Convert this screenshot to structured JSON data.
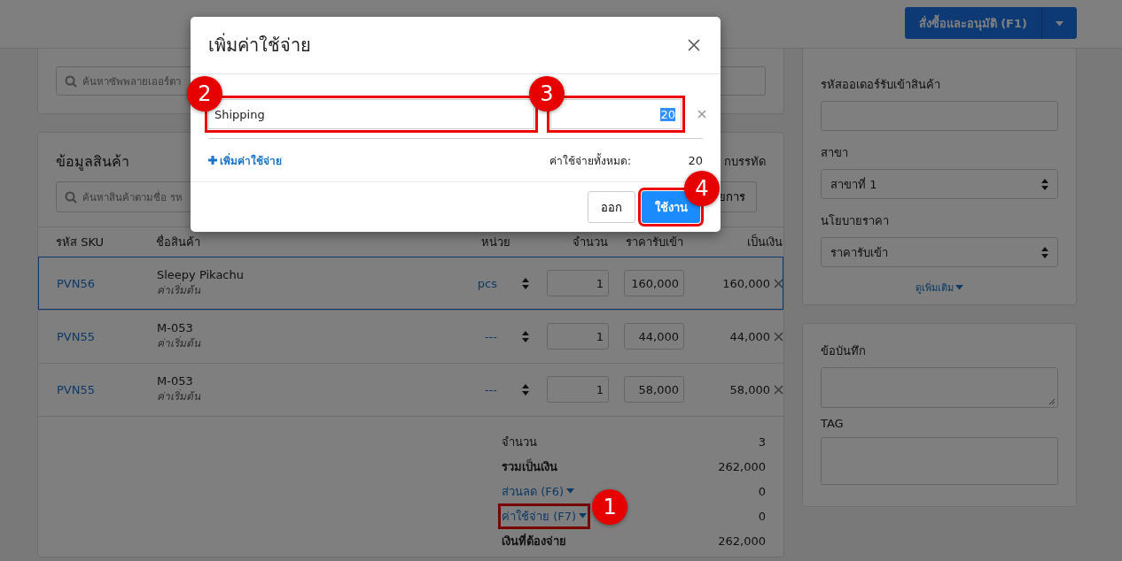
{
  "header": {
    "primary_button": "สั่งซื้อและอนุมัติ (F1)"
  },
  "supplier_card": {
    "search_placeholder": "ค้นหาซัพพลายเออร์ตา"
  },
  "products_card": {
    "title": "ข้อมูลสินค้า",
    "right_link": "กบรรทัด",
    "search_placeholder": "ค้นหาสินค้าตามชื่อ รห",
    "button": "ยการ",
    "columns": [
      "รหัส SKU",
      "ชื่อสินค้า",
      "หน่วย",
      "จำนวน",
      "ราคารับเข้า",
      "เป็นเงิน"
    ],
    "rows": [
      {
        "sku": "PVN56",
        "name": "Sleepy Pikachu",
        "note": "ค่าเริ่มต้น",
        "unit": "pcs",
        "qty": "1",
        "price": "160,000",
        "total": "160,000",
        "selected": true
      },
      {
        "sku": "PVN55",
        "name": "M-053",
        "note": "ค่าเริ่มต้น",
        "unit": "---",
        "qty": "1",
        "price": "44,000",
        "total": "44,000",
        "selected": false
      },
      {
        "sku": "PVN55",
        "name": "M-053",
        "note": "ค่าเริ่มต้น",
        "unit": "---",
        "qty": "1",
        "price": "58,000",
        "total": "58,000",
        "selected": false
      }
    ]
  },
  "summary": [
    {
      "kind": "text",
      "label": "จำนวน",
      "value": "3"
    },
    {
      "kind": "text",
      "label": "รวมเป็นเงิน",
      "value": "262,000"
    },
    {
      "kind": "dropdown",
      "label": "ส่วนลด (F6)",
      "value": "0"
    },
    {
      "kind": "dropdown",
      "label": "ค่าใช้จ่าย (F7)",
      "value": "0",
      "callout": "1"
    },
    {
      "kind": "total",
      "label": "เงินที่ต้องจ่าย",
      "value": "262,000"
    }
  ],
  "side_info": {
    "fields": [
      {
        "kind": "input",
        "label": "รหัสออเดอร์รับเข้าสินค้า"
      },
      {
        "kind": "select",
        "label": "สาขา",
        "value": "สาขาที่ 1"
      },
      {
        "kind": "select",
        "label": "นโยบายราคา",
        "value": "ราคารับเข้า"
      }
    ],
    "more_link": "ดูเพิ่มเติม"
  },
  "notes_card": {
    "fields": [
      {
        "kind": "textarea",
        "label": "ข้อบันทึก"
      },
      {
        "kind": "box",
        "label": "TAG"
      }
    ]
  },
  "modal": {
    "title": "เพิ่มค่าใช้จ่าย",
    "expenses": [
      {
        "name": "Shipping",
        "amount": "20",
        "amount_selected": true,
        "name_callout": "2",
        "amount_callout": "3"
      }
    ],
    "add_link": "เพิ่มค่าใช้จ่าย",
    "total_label": "ค่าใช้จ่ายทั้งหมด:",
    "total_value": "20",
    "buttons": [
      {
        "kind": "secondary",
        "label": "ออก"
      },
      {
        "kind": "primary",
        "label": "ใช้งาน",
        "callout": "4"
      }
    ]
  }
}
